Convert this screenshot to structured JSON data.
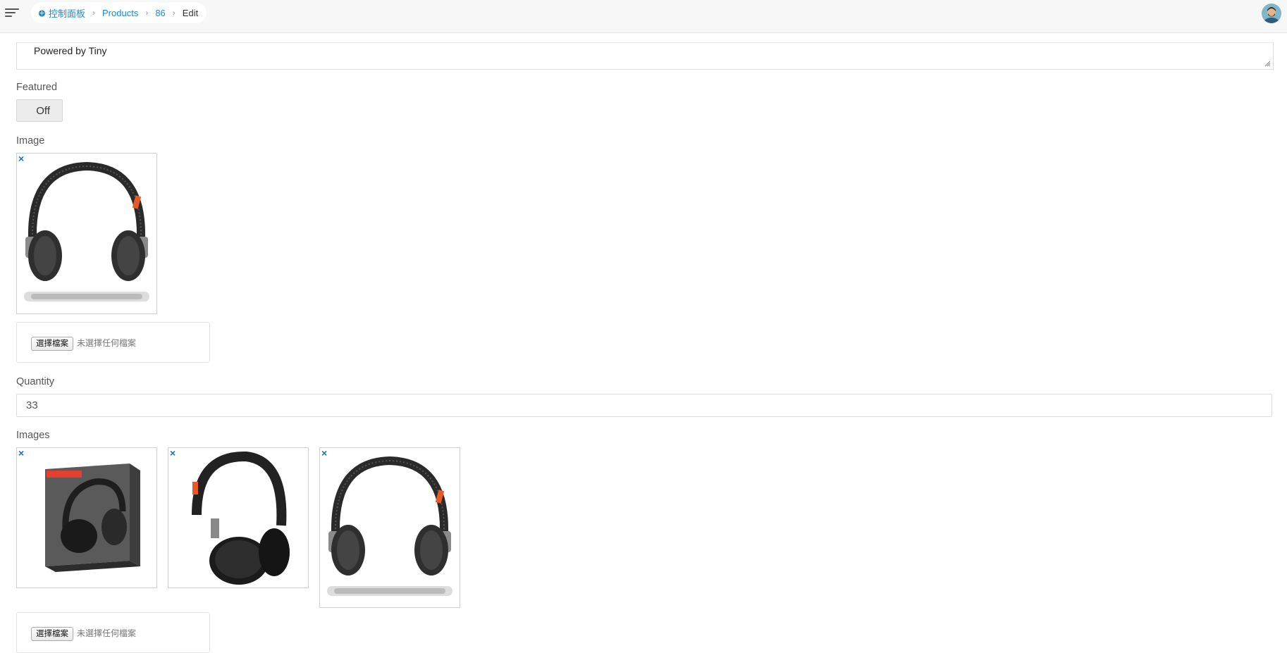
{
  "breadcrumb": {
    "home": "控制面板",
    "items": [
      "Products",
      "86"
    ],
    "current": "Edit"
  },
  "editor": {
    "powered_by": "Powered by Tiny"
  },
  "featured": {
    "label": "Featured",
    "toggle_label": "Off"
  },
  "image": {
    "label": "Image",
    "remove_glyph": "×",
    "file_button": "選擇檔案",
    "file_status": "未選擇任何檔案"
  },
  "quantity": {
    "label": "Quantity",
    "value": "33"
  },
  "images": {
    "label": "Images",
    "remove_glyph": "×",
    "file_button": "選擇檔案",
    "file_status": "未選擇任何檔案"
  },
  "colors": {
    "link": "#1a8ad4",
    "remove": "#1a6fb5",
    "topbar": "#f7f7f8"
  },
  "icons": {
    "menu": "hamburger-menu-icon",
    "home": "dashboard-icon",
    "separator": "chevron-right-icon"
  }
}
